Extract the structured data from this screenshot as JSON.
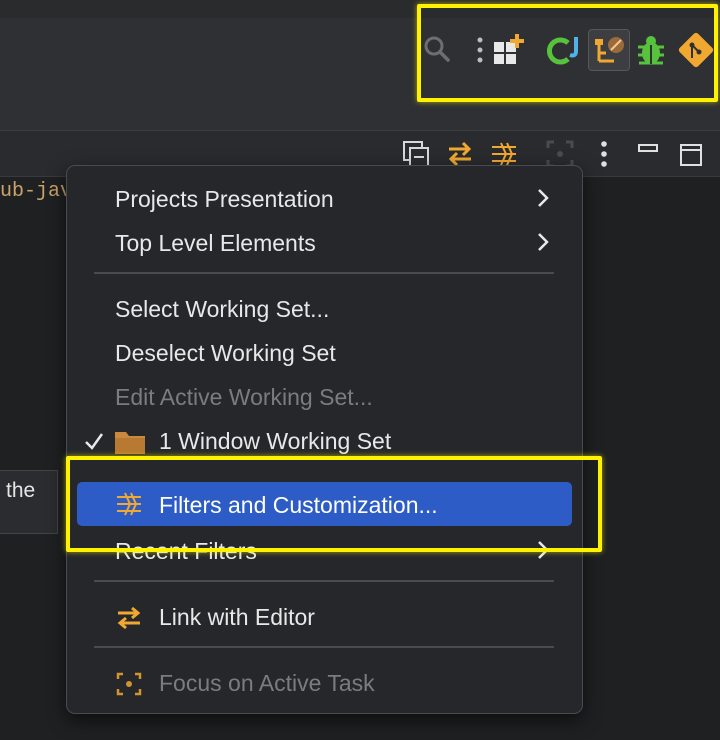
{
  "project_text": "ub-java",
  "side_panel_text": "the",
  "menu": {
    "items": [
      {
        "label": "Projects Presentation"
      },
      {
        "label": "Top Level Elements"
      },
      {
        "label": "Select Working Set..."
      },
      {
        "label": "Deselect Working Set"
      },
      {
        "label": "Edit Active Working Set..."
      },
      {
        "label": "1 Window Working Set"
      },
      {
        "label": "Filters and Customization..."
      },
      {
        "label": "Recent Filters"
      },
      {
        "label": "Link with Editor"
      },
      {
        "label": "Focus on Active Task"
      }
    ]
  },
  "colors": {
    "accent_selection": "#2e5cc6",
    "annotation_highlight": "#fff200",
    "icon_orange": "#f0a830",
    "icon_green": "#57c23b",
    "disabled_text": "#7b7c80"
  },
  "icons": {
    "toolbar": [
      "search-icon",
      "more-vertical-icon",
      "add-perspective-icon",
      "java-perspective-icon",
      "hierarchy-perspective-icon",
      "debug-perspective-icon",
      "git-perspective-icon"
    ],
    "viewbar": [
      "collapse-all-icon",
      "link-with-editor-icon",
      "filters-icon",
      "focus-task-icon",
      "view-menu-icon",
      "minimize-icon",
      "maximize-icon"
    ]
  }
}
